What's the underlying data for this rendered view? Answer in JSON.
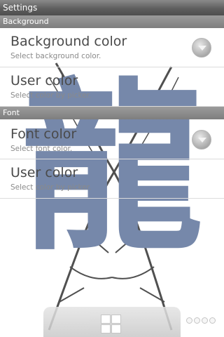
{
  "window": {
    "title": "Settings"
  },
  "sections": [
    {
      "header": "Background",
      "items": [
        {
          "title": "Background color",
          "subtitle": "Select background color."
        },
        {
          "title": "User color",
          "subtitle": "Select color by picker."
        }
      ]
    },
    {
      "header": "Font",
      "items": [
        {
          "title": "Font color",
          "subtitle": "Select font color."
        },
        {
          "title": "User color",
          "subtitle": "Select color by picker."
        }
      ]
    }
  ],
  "background_art": {
    "glyph": "龍",
    "glyph_color": "#7688aa"
  },
  "dock": {
    "icon": "grid-icon"
  },
  "page_indicator": {
    "icon": "page-dots-icon",
    "count": 4
  }
}
